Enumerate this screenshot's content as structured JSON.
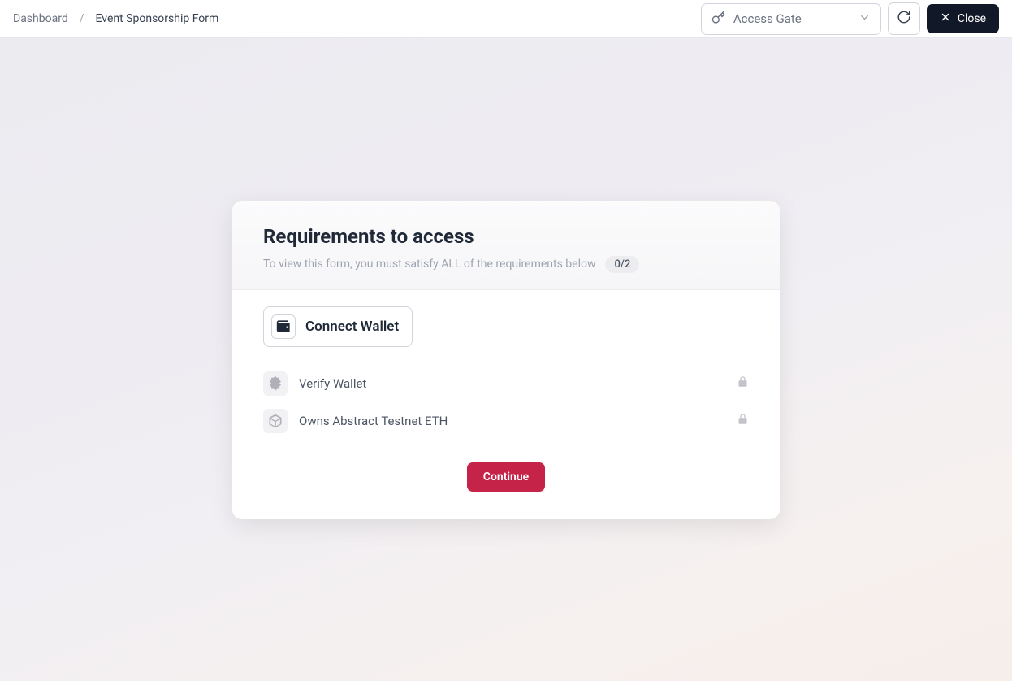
{
  "header": {
    "breadcrumb": {
      "root": "Dashboard",
      "separator": "/",
      "current": "Event Sponsorship Form"
    },
    "dropdown": {
      "label": "Access Gate"
    },
    "close_label": "Close"
  },
  "card": {
    "title": "Requirements to access",
    "subtitle": "To view this form, you must satisfy ALL of the requirements below",
    "progress": "0/2",
    "connect_label": "Connect Wallet",
    "requirements": [
      {
        "label": "Verify Wallet"
      },
      {
        "label": "Owns Abstract Testnet ETH"
      }
    ],
    "continue_label": "Continue"
  }
}
